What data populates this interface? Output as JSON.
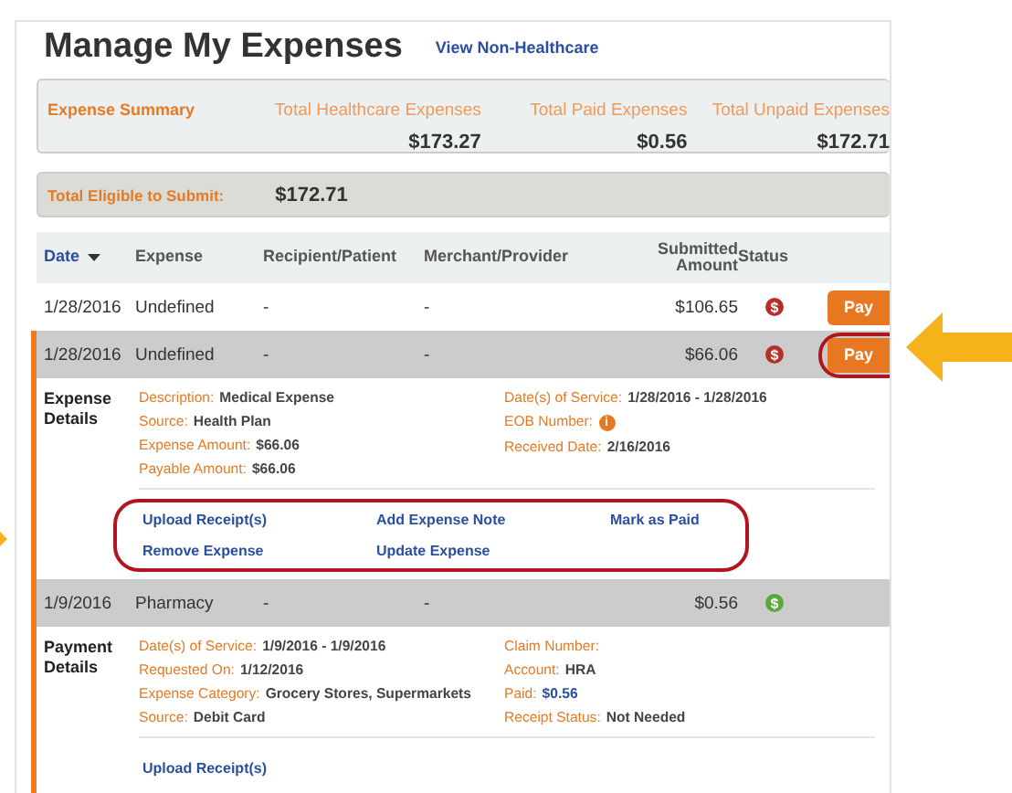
{
  "title": "Manage My Expenses",
  "view_link": "View Non-Healthcare",
  "summary": {
    "label": "Expense Summary",
    "items": [
      {
        "label": "Total Healthcare Expenses",
        "value": "$173.27"
      },
      {
        "label": "Total Paid Expenses",
        "value": "$0.56"
      },
      {
        "label": "Total Unpaid Expenses",
        "value": "$172.71"
      }
    ]
  },
  "eligible": {
    "label": "Total Eligible to Submit:",
    "value": "$172.71"
  },
  "columns": [
    {
      "label": "Date",
      "sorted": true
    },
    {
      "label": "Expense",
      "sorted": false
    },
    {
      "label": "Recipient/Patient",
      "sorted": false
    },
    {
      "label": "Merchant/Provider",
      "sorted": false
    },
    {
      "label": "Submitted Amount",
      "sorted": false
    },
    {
      "label": "Status",
      "sorted": false
    }
  ],
  "rows": [
    {
      "date": "1/28/2016",
      "expense": "Undefined",
      "recipient": "-",
      "merchant": "-",
      "amount": "$106.65",
      "status": {
        "symbol": "$",
        "color": "#b5302a"
      },
      "pay": "Pay",
      "expanded": false,
      "highlighted": false
    },
    {
      "date": "1/28/2016",
      "expense": "Undefined",
      "recipient": "-",
      "merchant": "-",
      "amount": "$66.06",
      "status": {
        "symbol": "$",
        "color": "#b5302a"
      },
      "pay": "Pay",
      "expanded": true,
      "highlighted": true,
      "details": {
        "title": "Expense Details",
        "left": [
          {
            "label": "Description:",
            "value": "Medical Expense"
          },
          {
            "label": "Source:",
            "value": "Health Plan"
          },
          {
            "label": "Expense Amount:",
            "value": "$66.06"
          },
          {
            "label": "Payable Amount:",
            "value": "$66.06"
          }
        ],
        "right": [
          {
            "label": "Date(s) of Service:",
            "value": "1/28/2016 - 1/28/2016"
          },
          {
            "label": "EOB Number:",
            "kind": "info",
            "value": "i"
          },
          {
            "label": "Received Date:",
            "value": "2/16/2016"
          }
        ],
        "actions": [
          "Upload Receipt(s)",
          "Add Expense Note",
          "Mark as Paid",
          "Remove Expense",
          "Update Expense"
        ],
        "actions_highlighted": true
      }
    },
    {
      "date": "1/9/2016",
      "expense": "Pharmacy",
      "recipient": "-",
      "merchant": "-",
      "amount": "$0.56",
      "status": {
        "symbol": "$",
        "color": "#5aa83a"
      },
      "expanded": true,
      "details": {
        "title": "Payment Details",
        "left": [
          {
            "label": "Date(s) of Service:",
            "value": "1/9/2016 - 1/9/2016"
          },
          {
            "label": "Requested On:",
            "value": "1/12/2016"
          },
          {
            "label": "Expense Category:",
            "value": "Grocery Stores, Supermarkets"
          },
          {
            "label": "Source:",
            "value": "Debit Card"
          }
        ],
        "right": [
          {
            "label": "Claim Number:"
          },
          {
            "label": "Account:",
            "value": "HRA"
          },
          {
            "label": "Paid:",
            "kind": "link",
            "value": "$0.56"
          },
          {
            "label": "Receipt Status:",
            "value": "Not Needed"
          }
        ],
        "actions": [
          "Upload Receipt(s)"
        ],
        "actions_highlighted": false
      }
    }
  ]
}
